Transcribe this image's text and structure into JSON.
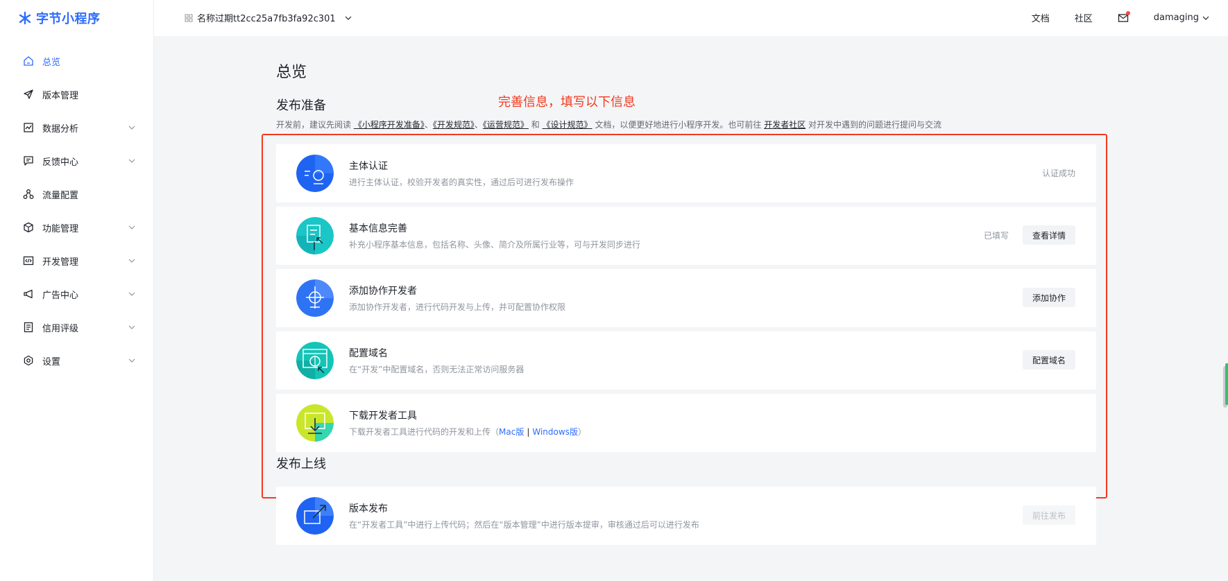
{
  "brand": {
    "name": "字节小程序",
    "accent": "#2c6bff"
  },
  "topbar": {
    "app_name": "名称过期tt2cc25a7fb3fa92c301",
    "links": [
      "文档",
      "社区"
    ],
    "user": "damaging"
  },
  "sidebar": {
    "items": [
      {
        "label": "总览",
        "icon": "home-icon",
        "active": true,
        "has_children": false
      },
      {
        "label": "版本管理",
        "icon": "send-icon",
        "active": false,
        "has_children": false
      },
      {
        "label": "数据分析",
        "icon": "chart-icon",
        "active": false,
        "has_children": true
      },
      {
        "label": "反馈中心",
        "icon": "message-icon",
        "active": false,
        "has_children": true
      },
      {
        "label": "流量配置",
        "icon": "share-icon",
        "active": false,
        "has_children": false
      },
      {
        "label": "功能管理",
        "icon": "cube-icon",
        "active": false,
        "has_children": true
      },
      {
        "label": "开发管理",
        "icon": "code-icon",
        "active": false,
        "has_children": true
      },
      {
        "label": "广告中心",
        "icon": "megaphone-icon",
        "active": false,
        "has_children": true
      },
      {
        "label": "信用评级",
        "icon": "document-icon",
        "active": false,
        "has_children": true
      },
      {
        "label": "设置",
        "icon": "settings-icon",
        "active": false,
        "has_children": true
      }
    ]
  },
  "main": {
    "title": "总览",
    "annotation": "完善信息，填写以下信息",
    "prep": {
      "title": "发布准备",
      "intro": {
        "prefix": "开发前，建议先阅读 ",
        "link1": "《小程序开发准备》",
        "sep1": "、",
        "link2": "《开发规范》",
        "sep2": "、",
        "link3": "《运营规范》",
        "and": " 和 ",
        "link4": "《设计规范》",
        "middle": " 文档，以便更好地进行小程序开发。也可前往 ",
        "link5": "开发者社区",
        "suffix": " 对开发中遇到的问题进行提问与交流"
      },
      "cards": [
        {
          "title": "主体认证",
          "desc": "进行主体认证，校验开发者的真实性，通过后可进行发布操作",
          "status": "认证成功"
        },
        {
          "title": "基本信息完善",
          "desc": "补充小程序基本信息，包括名称、头像、简介及所属行业等，可与开发同步进行",
          "status": "已填写",
          "button": "查看详情"
        },
        {
          "title": "添加协作开发者",
          "desc": "添加协作开发者，进行代码开发与上传，并可配置协作权限",
          "button": "添加协作"
        },
        {
          "title": "配置域名",
          "desc": "在“开发”中配置域名，否则无法正常访问服务器",
          "button": "配置域名"
        },
        {
          "title": "下载开发者工具",
          "desc_prefix": "下载开发者工具进行代码的开发和上传（",
          "mac": "Mac版",
          "sep": "|",
          "win": "Windows版",
          "desc_suffix": "）"
        }
      ]
    },
    "release": {
      "title": "发布上线",
      "cards": [
        {
          "title": "版本发布",
          "desc": "在“开发者工具”中进行上传代码；然后在“版本管理”中进行版本提审，审核通过后可以进行发布",
          "button": "前往发布"
        }
      ]
    }
  }
}
